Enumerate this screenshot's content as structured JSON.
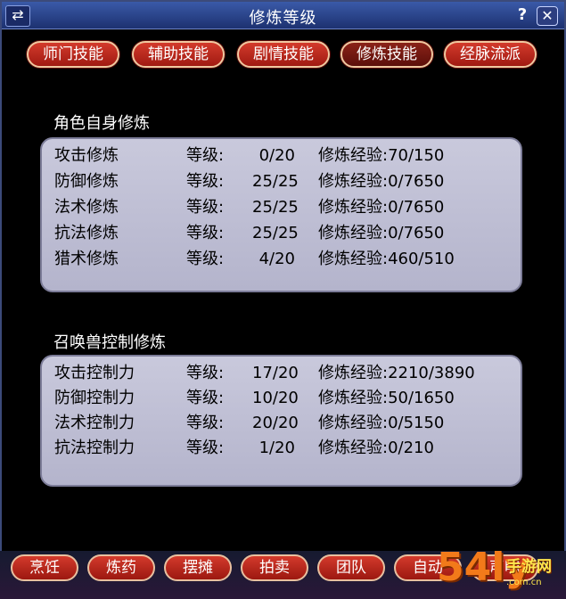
{
  "window": {
    "title": "修炼等级",
    "help": "?",
    "close": "✕",
    "corner": "⇄"
  },
  "tabs": [
    {
      "label": "师门技能",
      "active": false
    },
    {
      "label": "辅助技能",
      "active": false
    },
    {
      "label": "剧情技能",
      "active": false
    },
    {
      "label": "修炼技能",
      "active": true
    },
    {
      "label": "经脉流派",
      "active": false
    }
  ],
  "sections": [
    {
      "title": "角色自身修炼",
      "rows": [
        {
          "name": "攻击修炼",
          "level_label": "等级:",
          "level": "0/20",
          "exp": "修炼经验:70/150"
        },
        {
          "name": "防御修炼",
          "level_label": "等级:",
          "level": "25/25",
          "exp": "修炼经验:0/7650"
        },
        {
          "name": "法术修炼",
          "level_label": "等级:",
          "level": "25/25",
          "exp": "修炼经验:0/7650"
        },
        {
          "name": "抗法修炼",
          "level_label": "等级:",
          "level": "25/25",
          "exp": "修炼经验:0/7650"
        },
        {
          "name": "猎术修炼",
          "level_label": "等级:",
          "level": "4/20",
          "exp": "修炼经验:460/510"
        }
      ]
    },
    {
      "title": "召唤兽控制修炼",
      "rows": [
        {
          "name": "攻击控制力",
          "level_label": "等级:",
          "level": "17/20",
          "exp": "修炼经验:2210/3890"
        },
        {
          "name": "防御控制力",
          "level_label": "等级:",
          "level": "10/20",
          "exp": "修炼经验:50/1650"
        },
        {
          "name": "法术控制力",
          "level_label": "等级:",
          "level": "20/20",
          "exp": "修炼经验:0/5150"
        },
        {
          "name": "抗法控制力",
          "level_label": "等级:",
          "level": "1/20",
          "exp": "修炼经验:0/210"
        }
      ]
    }
  ],
  "bottom_buttons": [
    "烹饪",
    "炼药",
    "摆摊",
    "拍卖",
    "团队",
    "自动",
    "声明"
  ],
  "watermark": {
    "big": "54ly",
    "cn": "手游网",
    "url": ".com.cn"
  }
}
